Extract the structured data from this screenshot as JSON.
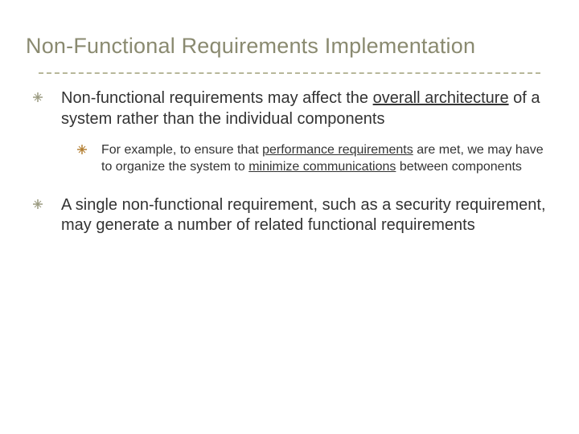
{
  "title": "Non-Functional Requirements Implementation",
  "points": [
    {
      "pre": "Non-functional requirements may affect the ",
      "u1": "overall architecture",
      "post": " of a system rather than the individual components",
      "sub": {
        "pre": "For example, to ensure that ",
        "u1": "performance requirements",
        "mid": " are met, we may have to organize the system to ",
        "u2": "minimize communications",
        "post": " between components"
      }
    },
    {
      "text": "A single non-functional requirement, such as a security requirement, may generate a number of related functional requirements"
    }
  ]
}
